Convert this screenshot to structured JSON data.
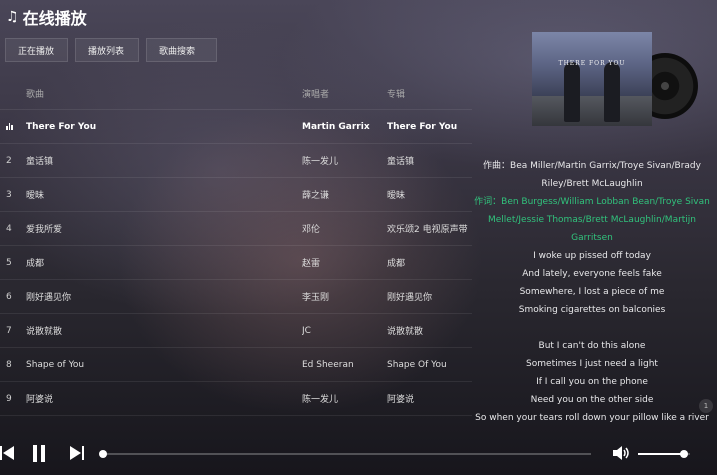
{
  "app": {
    "title": "在线播放",
    "icon": "music-note-icon"
  },
  "tabs": [
    {
      "label": "正在播放"
    },
    {
      "label": "播放列表"
    },
    {
      "label": "歌曲搜索"
    }
  ],
  "list": {
    "headers": {
      "song": "歌曲",
      "artist": "演唱者",
      "album": "专辑"
    },
    "rows": [
      {
        "idx": "",
        "song": "There For You",
        "artist": "Martin Garrix",
        "album": "There For You",
        "playing": true
      },
      {
        "idx": "2",
        "song": "童话镇",
        "artist": "陈一发儿",
        "album": "童话镇"
      },
      {
        "idx": "3",
        "song": "暧昧",
        "artist": "薛之谦",
        "album": "暧昧"
      },
      {
        "idx": "4",
        "song": "爱我所爱",
        "artist": "邓伦",
        "album": "欢乐颂2 电视原声带"
      },
      {
        "idx": "5",
        "song": "成都",
        "artist": "赵雷",
        "album": "成都"
      },
      {
        "idx": "6",
        "song": "刚好遇见你",
        "artist": "李玉刚",
        "album": "刚好遇见你"
      },
      {
        "idx": "7",
        "song": "说散就散",
        "artist": "JC",
        "album": "说散就散"
      },
      {
        "idx": "8",
        "song": "Shape of You",
        "artist": "Ed Sheeran",
        "album": "Shape Of You"
      },
      {
        "idx": "9",
        "song": "阿婆说",
        "artist": "陈一发儿",
        "album": "阿婆说"
      }
    ]
  },
  "cover": {
    "text": "THERE FOR YOU"
  },
  "lyrics": {
    "composer": "作曲：Bea Miller/Martin Garrix/Troye Sivan/Brady Riley/Brett McLaughlin",
    "lyricist": "作词：Ben Burgess/William Lobban Bean/Troye Sivan Mellet/Jessie Thomas/Brett McLaughlin/Martijn Garritsen",
    "lines1": [
      "I woke up pissed off today",
      "And lately, everyone feels fake",
      "Somewhere, I lost a piece of me",
      "Smoking cigarettes on balconies"
    ],
    "lines2": [
      "But I can't do this alone",
      "Sometimes I just need a light",
      "If I call you on the phone",
      "Need you on the other side",
      "So when your tears roll down your pillow like a river"
    ],
    "highlight_color": "#31c27c"
  },
  "scroll_badge": "1",
  "player": {
    "progress": 0.0,
    "volume": 0.88,
    "icons": {
      "prev": "skip-previous-icon",
      "pause": "pause-icon",
      "next": "skip-next-icon",
      "volume": "volume-icon"
    }
  }
}
